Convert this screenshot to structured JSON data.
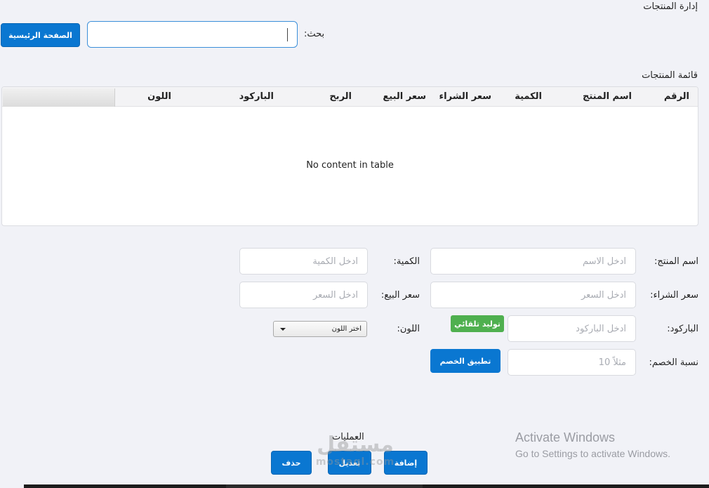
{
  "page": {
    "title": "إدارة المنتجات"
  },
  "header": {
    "home_button": "الصفحة الرئيسية",
    "search_label": "بحث:",
    "search_value": ""
  },
  "table": {
    "title": "قائمة المنتجات",
    "columns": [
      "الرقم",
      "اسم المنتج",
      "الكمية",
      "سعر الشراء",
      "سعر البيع",
      "الربح",
      "الباركود",
      "اللون"
    ],
    "empty_message": "No content in table"
  },
  "form": {
    "name_label": "اسم المنتج:",
    "name_placeholder": "ادخل الاسم",
    "quantity_label": "الكمية:",
    "quantity_placeholder": "ادخل الكمية",
    "buy_price_label": "سعر الشراء:",
    "buy_price_placeholder": "ادخل السعر",
    "sell_price_label": "سعر البيع:",
    "sell_price_placeholder": "ادخل السعر",
    "barcode_label": "الباركود:",
    "barcode_placeholder": "ادخل الباركود",
    "generate_button": "توليد تلقائي",
    "color_label": "اللون:",
    "color_select_value": "اختر اللون",
    "discount_label": "نسبة الخصم:",
    "discount_placeholder": "مثلاً 10",
    "apply_discount_button": "تطبيق الخصم"
  },
  "operations": {
    "title": "العمليات",
    "add_button": "إضافة",
    "edit_button": "تعديل",
    "delete_button": "حذف"
  },
  "watermark": {
    "line1": "مستقل",
    "line2": "mostaql.com"
  },
  "windows_activation": {
    "title": "Activate Windows",
    "subtitle": "Go to Settings to activate Windows."
  },
  "colors": {
    "primary": "#0a77d1",
    "success": "#4fb04f",
    "background": "#f1f2f7"
  }
}
